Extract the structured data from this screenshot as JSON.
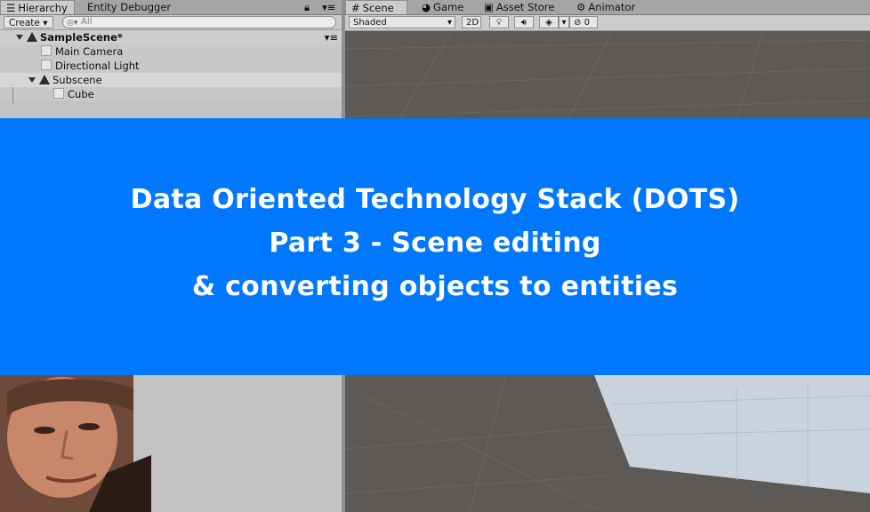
{
  "hierarchy": {
    "tabs": [
      {
        "label": "Hierarchy",
        "icon": "list-icon"
      },
      {
        "label": "Entity Debugger",
        "icon": ""
      }
    ],
    "create_label": "Create",
    "search_placeholder": "All",
    "rows": [
      {
        "label": "SampleScene*",
        "icon": "unity-icon",
        "expanded": true
      },
      {
        "label": "Main Camera",
        "icon": "cube-icon"
      },
      {
        "label": "Directional Light",
        "icon": "cube-icon"
      },
      {
        "label": "Subscene",
        "icon": "unity-icon",
        "expanded": true
      },
      {
        "label": "Cube",
        "icon": "cube-icon"
      }
    ]
  },
  "scene": {
    "tabs": [
      {
        "label": "Scene",
        "icon": "grid-icon"
      },
      {
        "label": "Game",
        "icon": "pacman-icon"
      },
      {
        "label": "Asset Store",
        "icon": "bag-icon"
      },
      {
        "label": "Animator",
        "icon": "animator-icon"
      }
    ],
    "shading_mode": "Shaded",
    "mode_2d": "2D",
    "hidden_count": "0"
  },
  "banner": {
    "line1": "Data Oriented Technology Stack (DOTS)",
    "line2": "Part 3 - Scene editing",
    "line3": "& converting objects to entities",
    "background": "#0077ff",
    "text_color": "#ffffff"
  }
}
